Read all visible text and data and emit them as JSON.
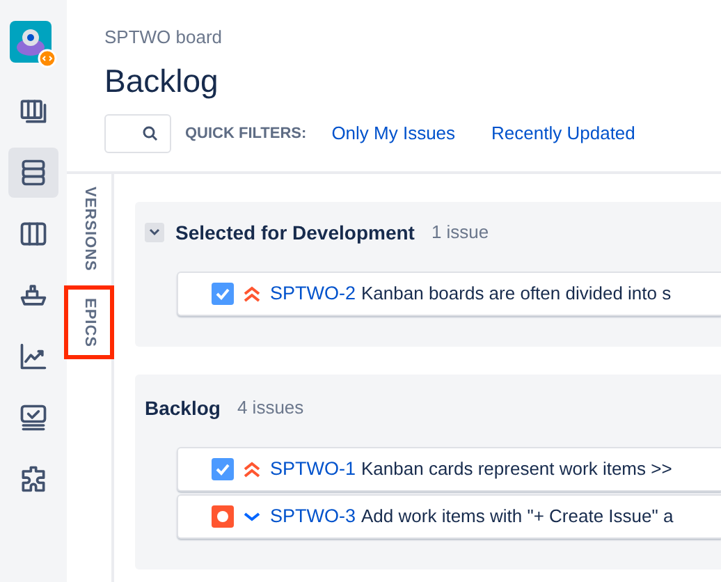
{
  "nav": {
    "items": [
      {
        "kind": "logo",
        "selected": false
      },
      {
        "kind": "boards",
        "selected": false
      },
      {
        "kind": "backlog",
        "selected": true
      },
      {
        "kind": "columns",
        "selected": false
      },
      {
        "kind": "releases",
        "selected": false
      },
      {
        "kind": "reports",
        "selected": false
      },
      {
        "kind": "monitor",
        "selected": false
      },
      {
        "kind": "addons",
        "selected": false
      }
    ]
  },
  "header": {
    "breadcrumb": "SPTWO board",
    "title": "Backlog",
    "quick_filters_label": "QUICK FILTERS:",
    "quick_filters": [
      "Only My Issues",
      "Recently Updated"
    ]
  },
  "side_tabs": [
    {
      "label": "VERSIONS",
      "highlighted": false
    },
    {
      "label": "EPICS",
      "highlighted": true
    }
  ],
  "sections": [
    {
      "title": "Selected for Development",
      "count": "1 issue",
      "collapsible": true,
      "issues": [
        {
          "type_icon": {
            "kind": "task"
          },
          "priority_icon": {
            "kind": "highest"
          },
          "key": "SPTWO-2",
          "summary": "Kanban boards are often divided into s"
        }
      ]
    },
    {
      "title": "Backlog",
      "count": "4 issues",
      "collapsible": false,
      "issues": [
        {
          "type_icon": {
            "kind": "task"
          },
          "priority_icon": {
            "kind": "highest"
          },
          "key": "SPTWO-1",
          "summary": "Kanban cards represent work items >>"
        },
        {
          "type_icon": {
            "kind": "bug"
          },
          "priority_icon": {
            "kind": "low"
          },
          "key": "SPTWO-3",
          "summary": "Add work items with \"+ Create Issue\" a"
        }
      ]
    }
  ]
}
